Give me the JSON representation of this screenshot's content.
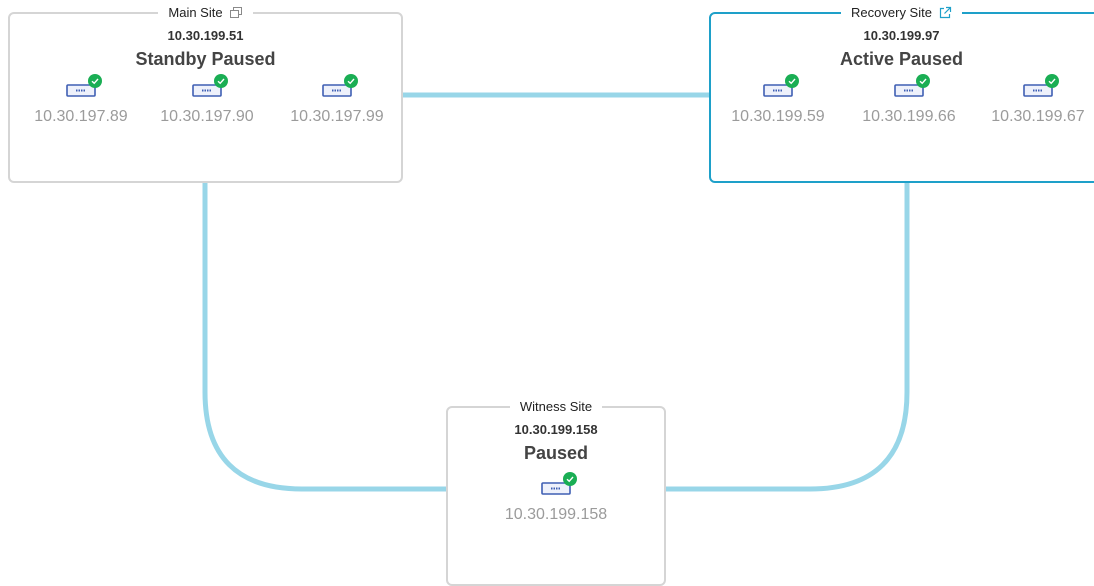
{
  "sites": {
    "main": {
      "title": "Main Site",
      "ip": "10.30.199.51",
      "status": "Standby Paused",
      "icon": "copy-window-icon",
      "nodes": [
        {
          "ip": "10.30.197.89",
          "state": "healthy"
        },
        {
          "ip": "10.30.197.90",
          "state": "healthy"
        },
        {
          "ip": "10.30.197.99",
          "state": "healthy"
        }
      ]
    },
    "recovery": {
      "title": "Recovery Site",
      "ip": "10.30.199.97",
      "status": "Active Paused",
      "icon": "external-link-icon",
      "nodes": [
        {
          "ip": "10.30.199.59",
          "state": "healthy"
        },
        {
          "ip": "10.30.199.66",
          "state": "healthy"
        },
        {
          "ip": "10.30.199.67",
          "state": "healthy"
        }
      ]
    },
    "witness": {
      "title": "Witness Site",
      "ip": "10.30.199.158",
      "status": "Paused",
      "nodes": [
        {
          "ip": "10.30.199.158",
          "state": "healthy"
        }
      ]
    }
  },
  "colors": {
    "connector": "#98d6e8",
    "active_border": "#1ea0c9",
    "inactive_border": "#d5d5d5",
    "device": "#3f5fb3",
    "healthy": "#1aae54"
  }
}
